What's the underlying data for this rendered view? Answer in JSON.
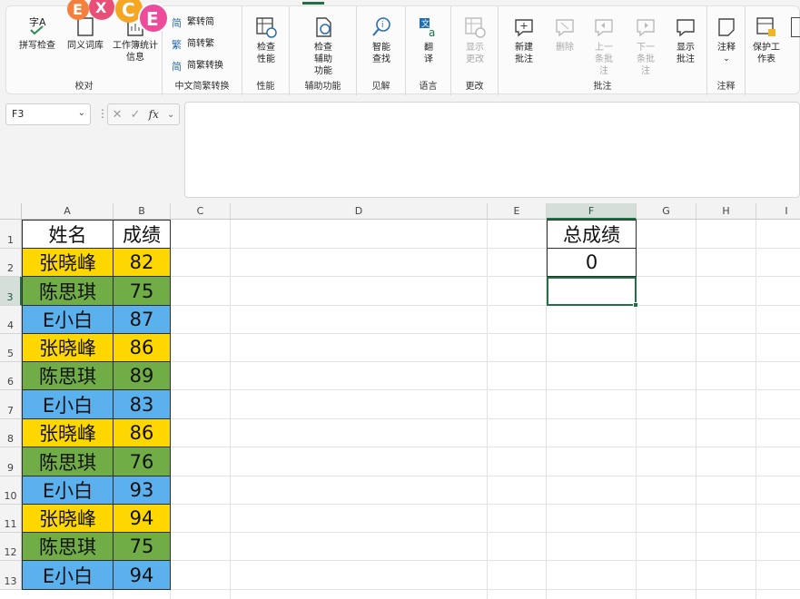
{
  "ribbon": {
    "groups": [
      {
        "label": "校对",
        "buttons": [
          {
            "label": "拼写检查",
            "icon": "spell-check-icon"
          },
          {
            "label": "同义词库",
            "icon": "thesaurus-icon"
          },
          {
            "label": "工作簿统计信息",
            "icon": "workbook-stats-icon"
          }
        ]
      },
      {
        "label": "中文简繁转换",
        "buttons": [
          {
            "label": "繁转简",
            "icon": "trad-to-simp-icon"
          },
          {
            "label": "简转繁",
            "icon": "simp-to-trad-icon"
          },
          {
            "label": "简繁转换",
            "icon": "convert-icon"
          }
        ]
      },
      {
        "label": "性能",
        "buttons": [
          {
            "label": "检查性能",
            "icon": "check-performance-icon"
          }
        ]
      },
      {
        "label": "辅助功能",
        "buttons": [
          {
            "label": "检查辅助功能",
            "icon": "accessibility-icon"
          }
        ]
      },
      {
        "label": "见解",
        "buttons": [
          {
            "label": "智能查找",
            "icon": "smart-lookup-icon"
          }
        ]
      },
      {
        "label": "语言",
        "buttons": [
          {
            "label": "翻译",
            "icon": "translate-icon"
          }
        ]
      },
      {
        "label": "更改",
        "buttons": [
          {
            "label": "显示更改",
            "icon": "show-changes-icon",
            "disabled": true
          }
        ]
      },
      {
        "label": "批注",
        "buttons": [
          {
            "label": "新建批注",
            "icon": "new-comment-icon"
          },
          {
            "label": "删除",
            "icon": "delete-comment-icon",
            "disabled": true
          },
          {
            "label": "上一条批注",
            "icon": "prev-comment-icon",
            "disabled": true
          },
          {
            "label": "下一条批注",
            "icon": "next-comment-icon",
            "disabled": true
          },
          {
            "label": "显示批注",
            "icon": "show-comments-icon"
          }
        ]
      },
      {
        "label": "注释",
        "buttons": [
          {
            "label": "注释",
            "icon": "notes-icon"
          }
        ]
      },
      {
        "label": "",
        "buttons": [
          {
            "label": "保护工作表",
            "icon": "protect-sheet-icon"
          }
        ]
      }
    ]
  },
  "logo": {
    "letters": [
      "E",
      "X",
      "C",
      "E"
    ]
  },
  "formula_bar": {
    "name_box": "F3",
    "fx": "fx",
    "value": ""
  },
  "columns": [
    "A",
    "B",
    "C",
    "D",
    "E",
    "F",
    "G",
    "H",
    "I"
  ],
  "rows": [
    "1",
    "2",
    "3",
    "4",
    "5",
    "6",
    "7",
    "8",
    "9",
    "10",
    "11",
    "12",
    "13"
  ],
  "selected": {
    "cell": "F3",
    "column": "F",
    "row": "3"
  },
  "table": {
    "headers": {
      "name": "姓名",
      "score": "成绩"
    },
    "rows": [
      {
        "name": "张晓峰",
        "score": "82",
        "color": "#ffd700"
      },
      {
        "name": "陈思琪",
        "score": "75",
        "color": "#70ad47"
      },
      {
        "name": "E小白",
        "score": "87",
        "color": "#5bb0ee"
      },
      {
        "name": "张晓峰",
        "score": "86",
        "color": "#ffd700"
      },
      {
        "name": "陈思琪",
        "score": "89",
        "color": "#70ad47"
      },
      {
        "name": "E小白",
        "score": "83",
        "color": "#5bb0ee"
      },
      {
        "name": "张晓峰",
        "score": "86",
        "color": "#ffd700"
      },
      {
        "name": "陈思琪",
        "score": "76",
        "color": "#70ad47"
      },
      {
        "name": "E小白",
        "score": "93",
        "color": "#5bb0ee"
      },
      {
        "name": "张晓峰",
        "score": "94",
        "color": "#ffd700"
      },
      {
        "name": "陈思琪",
        "score": "75",
        "color": "#70ad47"
      },
      {
        "name": "E小白",
        "score": "94",
        "color": "#5bb0ee"
      }
    ]
  },
  "total": {
    "label": "总成绩",
    "value": "0"
  }
}
